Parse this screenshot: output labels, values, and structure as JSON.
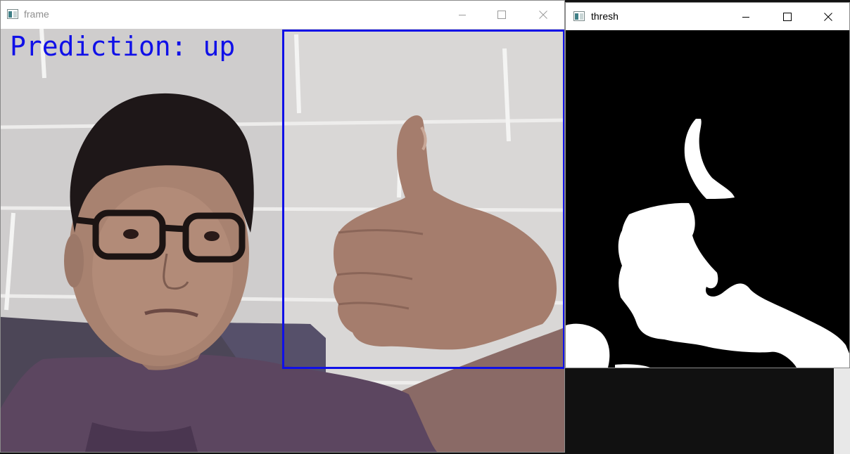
{
  "frame_window": {
    "title": "frame",
    "title_color": "#8f8f8f",
    "prediction_text": "Prediction: up",
    "overlay_color": "#1010e8"
  },
  "thresh_window": {
    "title": "thresh"
  },
  "window_controls": {
    "minimize_icon": "minimize-icon",
    "maximize_icon": "maximize-icon",
    "close_icon": "close-icon"
  },
  "colors": {
    "desktop_background": "#111111",
    "threshold_foreground": "#ffffff",
    "threshold_background": "#000000"
  }
}
